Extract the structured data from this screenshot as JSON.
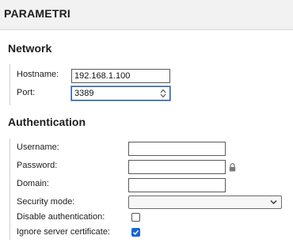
{
  "header": {
    "title": "PARAMETRI"
  },
  "network": {
    "heading": "Network",
    "hostname_label": "Hostname:",
    "hostname_value": "192.168.1.100",
    "port_label": "Port:",
    "port_value": "3389"
  },
  "auth": {
    "heading": "Authentication",
    "username_label": "Username:",
    "username_value": "",
    "password_label": "Password:",
    "password_value": "",
    "domain_label": "Domain:",
    "domain_value": "",
    "security_mode_label": "Security mode:",
    "security_mode_value": "",
    "disable_auth_label": "Disable authentication:",
    "disable_auth_checked": false,
    "ignore_cert_label": "Ignore server certificate:",
    "ignore_cert_checked": true
  },
  "icons": [
    "lock-icon",
    "spinner-arrows-icon",
    "chevron-down-icon",
    "checkmark-icon"
  ],
  "colors": {
    "accent": "#1565d8",
    "header_bg": "#f2f2f2"
  }
}
